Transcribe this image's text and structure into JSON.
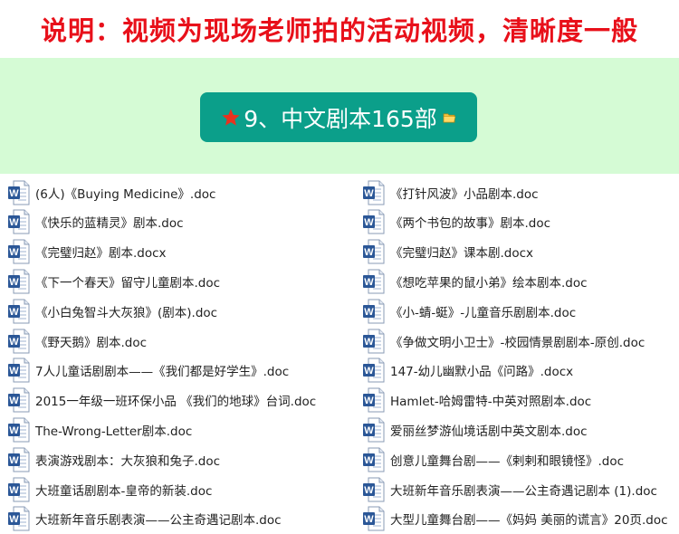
{
  "notice": {
    "text": "说明：视频为现场老师拍的活动视频，清晰度一般"
  },
  "banner": {
    "label": "9、中文剧本165部"
  },
  "files": {
    "left": [
      "(6人)《Buying Medicine》.doc",
      "《快乐的蓝精灵》剧本.doc",
      "《完璧归赵》剧本.docx",
      "《下一个春天》留守儿童剧本.doc",
      "《小白兔智斗大灰狼》(剧本).doc",
      "《野天鹅》剧本.doc",
      "7人儿童话剧剧本——《我们都是好学生》.doc",
      "2015一年级一班环保小品 《我们的地球》台词.doc",
      "The-Wrong-Letter剧本.doc",
      "表演游戏剧本：大灰狼和兔子.doc",
      "大班童话剧剧本-皇帝的新装.doc",
      "大班新年音乐剧表演——公主奇遇记剧本.doc"
    ],
    "right": [
      "《打针风波》小品剧本.doc",
      "《两个书包的故事》剧本.doc",
      "《完璧归赵》课本剧.docx",
      "《想吃苹果的鼠小弟》绘本剧本.doc",
      "《小-蜻-蜓》-儿童音乐剧剧本.doc",
      "《争做文明小卫士》-校园情景剧剧本-原创.doc",
      "147-幼儿幽默小品《问路》.docx",
      "Hamlet-哈姆雷特-中英对照剧本.doc",
      "爱丽丝梦游仙境话剧中英文剧本.doc",
      "创意儿童舞台剧——《剌剌和眼镜怪》.doc",
      "大班新年音乐剧表演——公主奇遇记剧本 (1).doc",
      "大型儿童舞台剧——《妈妈 美丽的谎言》20页.doc"
    ]
  },
  "icons": {
    "doc": "word-document-icon",
    "star": "star-icon",
    "folder": "folder-icon"
  },
  "colors": {
    "notice": "#e8101a",
    "banner_bg": "#d5fbd5",
    "badge_bg": "#0b9f8a",
    "word_blue": "#2b5797"
  }
}
